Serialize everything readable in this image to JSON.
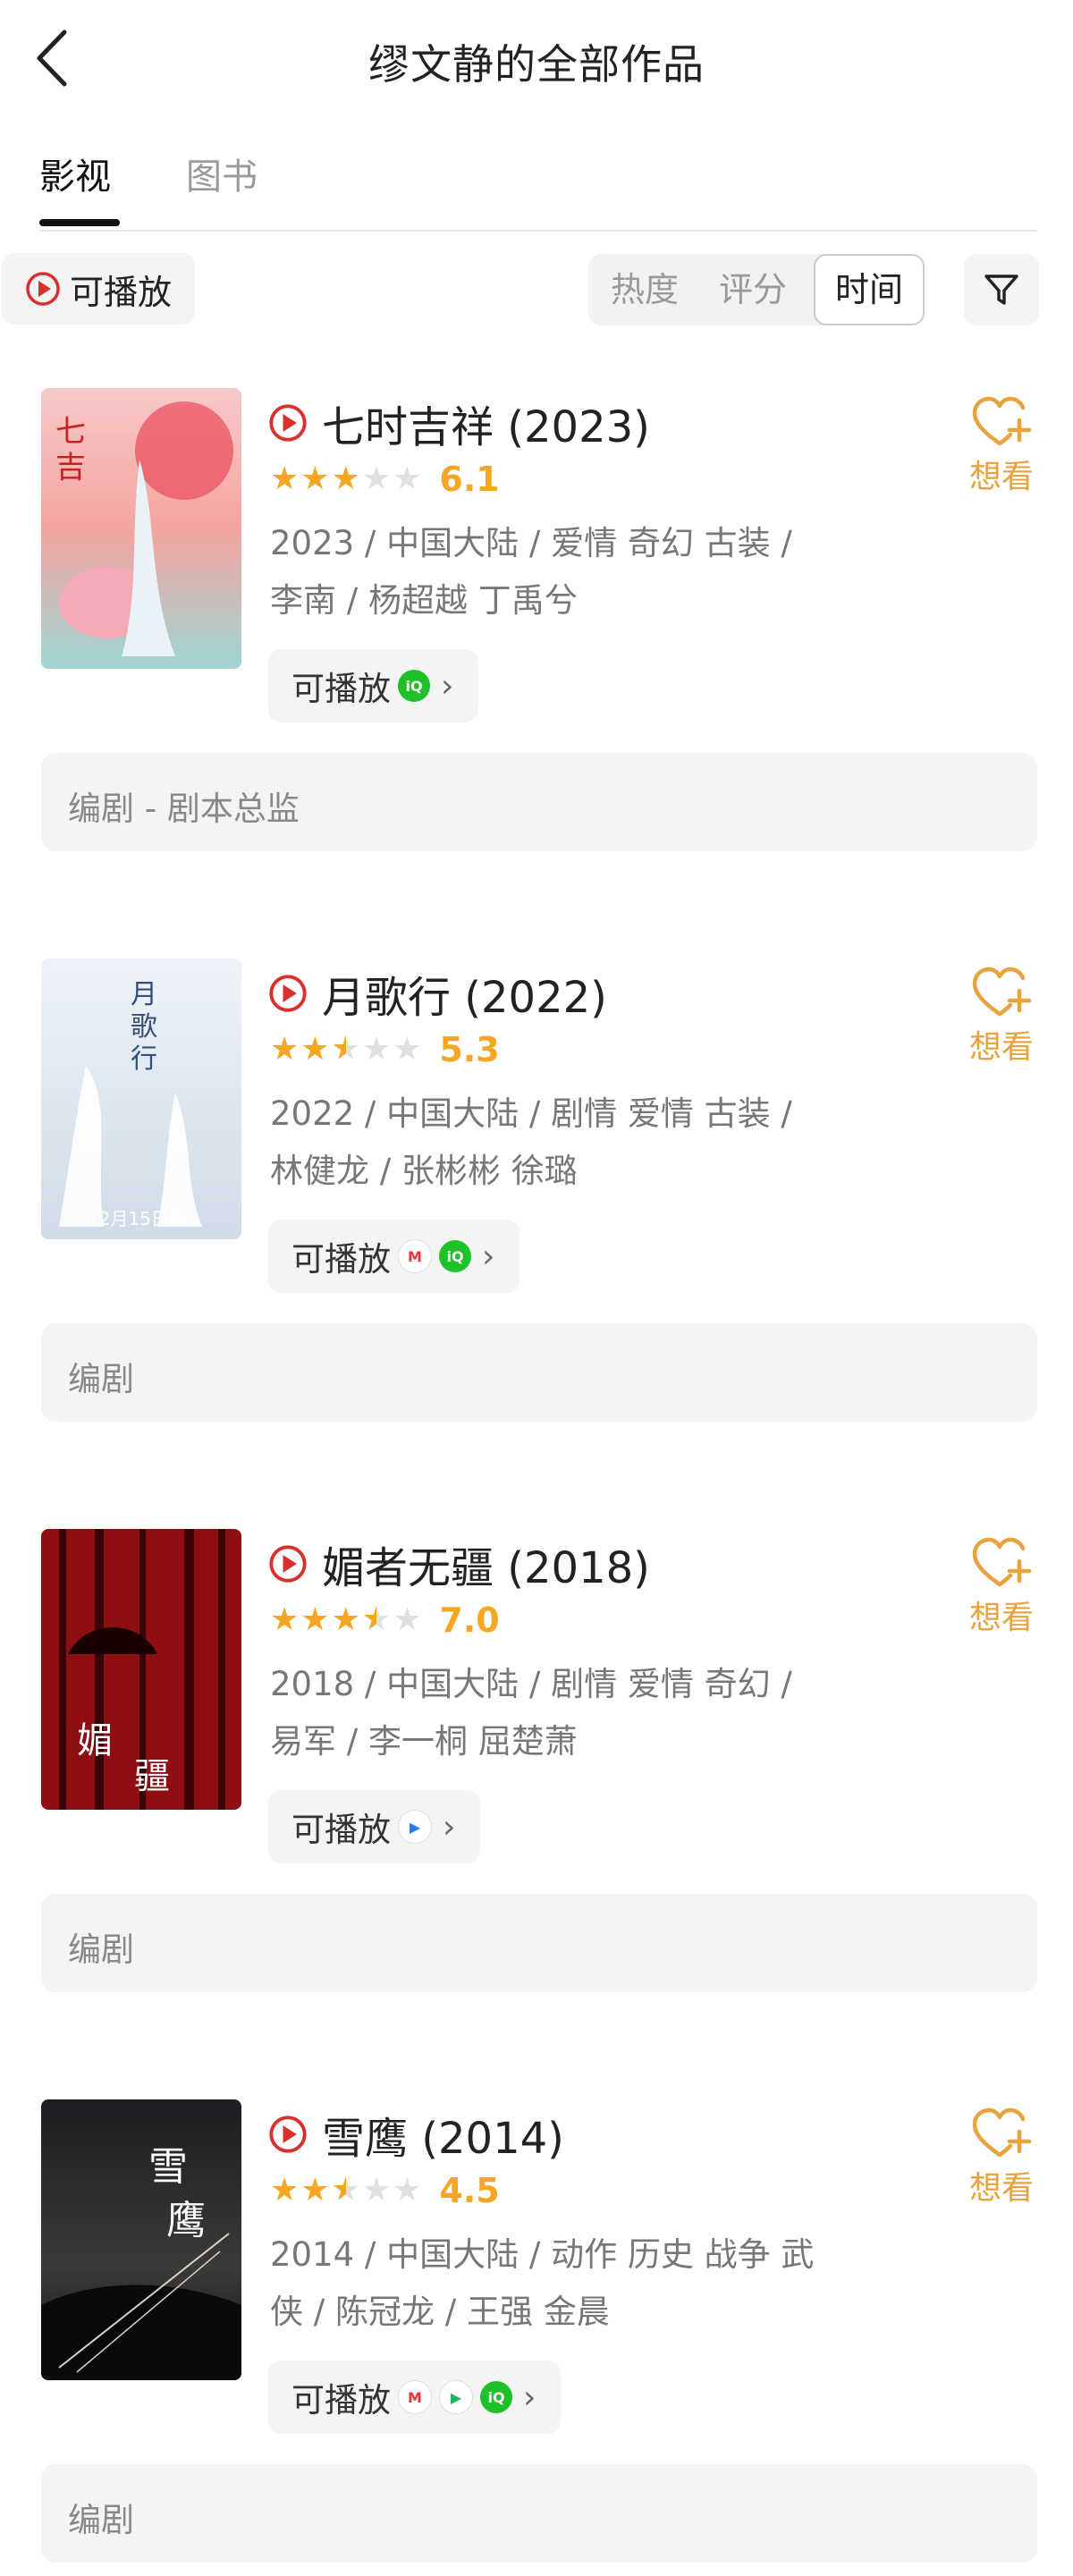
{
  "header": {
    "title": "缪文静的全部作品"
  },
  "tabs": [
    {
      "label": "影视"
    },
    {
      "label": "图书"
    }
  ],
  "filter": {
    "playable_label": "可播放",
    "sort_options": [
      "热度",
      "评分",
      "时间"
    ],
    "active_sort": "时间"
  },
  "colors": {
    "accent": "#f5a623",
    "brand_red": "#d9302e",
    "iqiyi": "#1ec128",
    "want": "#e8a33d"
  },
  "works": [
    {
      "title": "七时吉祥 (2023)",
      "stars": 3,
      "score": "6.1",
      "meta_line1": "2023 / 中国大陆 / 爱情 奇幻 古装 /",
      "meta_line2": "李南 / 杨超越 丁禹兮",
      "play_label": "可播放",
      "platforms": [
        "iqiyi-icon"
      ],
      "want_label": "想看",
      "role": "编剧 - 剧本总监"
    },
    {
      "title": "月歌行 (2022)",
      "stars": 2.5,
      "score": "5.3",
      "meta_line1": "2022 / 中国大陆 / 剧情 爱情 古装 /",
      "meta_line2": "林健龙 / 张彬彬 徐璐",
      "play_label": "可播放",
      "platforms": [
        "mgtv-icon",
        "iqiyi-icon"
      ],
      "want_label": "想看",
      "role": "编剧"
    },
    {
      "title": "媚者无疆 (2018)",
      "stars": 3.5,
      "score": "7.0",
      "meta_line1": "2018 / 中国大陆 / 剧情 爱情 奇幻 /",
      "meta_line2": "易军 / 李一桐 屈楚萧",
      "play_label": "可播放",
      "platforms": [
        "youku-icon"
      ],
      "want_label": "想看",
      "role": "编剧"
    },
    {
      "title": "雪鹰 (2014)",
      "stars": 2.5,
      "score": "4.5",
      "meta_line1": "2014 / 中国大陆 / 动作 历史 战争 武",
      "meta_line2": "侠 / 陈冠龙 / 王强 金晨",
      "play_label": "可播放",
      "platforms": [
        "mgtv-icon",
        "tencent-video-icon",
        "iqiyi-icon"
      ],
      "want_label": "想看",
      "role": "编剧"
    }
  ]
}
